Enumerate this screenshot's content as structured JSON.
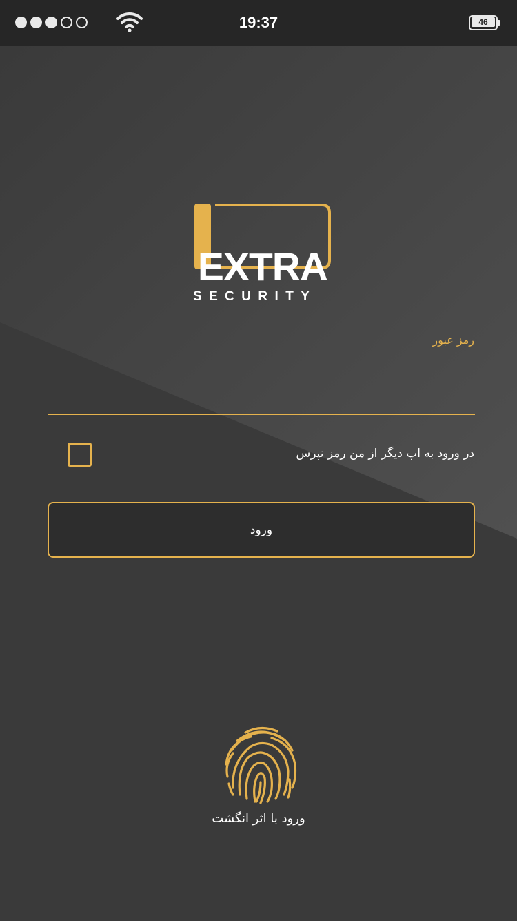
{
  "status_bar": {
    "signal_full": 3,
    "signal_empty": 2,
    "wifi_icon": "wifi-icon",
    "time": "19:37",
    "battery_level": "46"
  },
  "logo": {
    "icon": "battery-outline-logo",
    "title": "EXTRA",
    "subtitle": "SECURITY"
  },
  "login_form": {
    "password_label": "رمز عبور",
    "password_value": "",
    "remember_label": "در ورود به اپ دیگر از من رمز نپرس",
    "remember_checked": false,
    "login_button": "ورود"
  },
  "fingerprint": {
    "icon": "fingerprint-icon",
    "label": "ورود با اثر انگشت"
  },
  "colors": {
    "accent": "#e5b24d",
    "background_dark": "#2d2d2d",
    "background": "#3c3c3c",
    "status_bar": "#262626"
  }
}
